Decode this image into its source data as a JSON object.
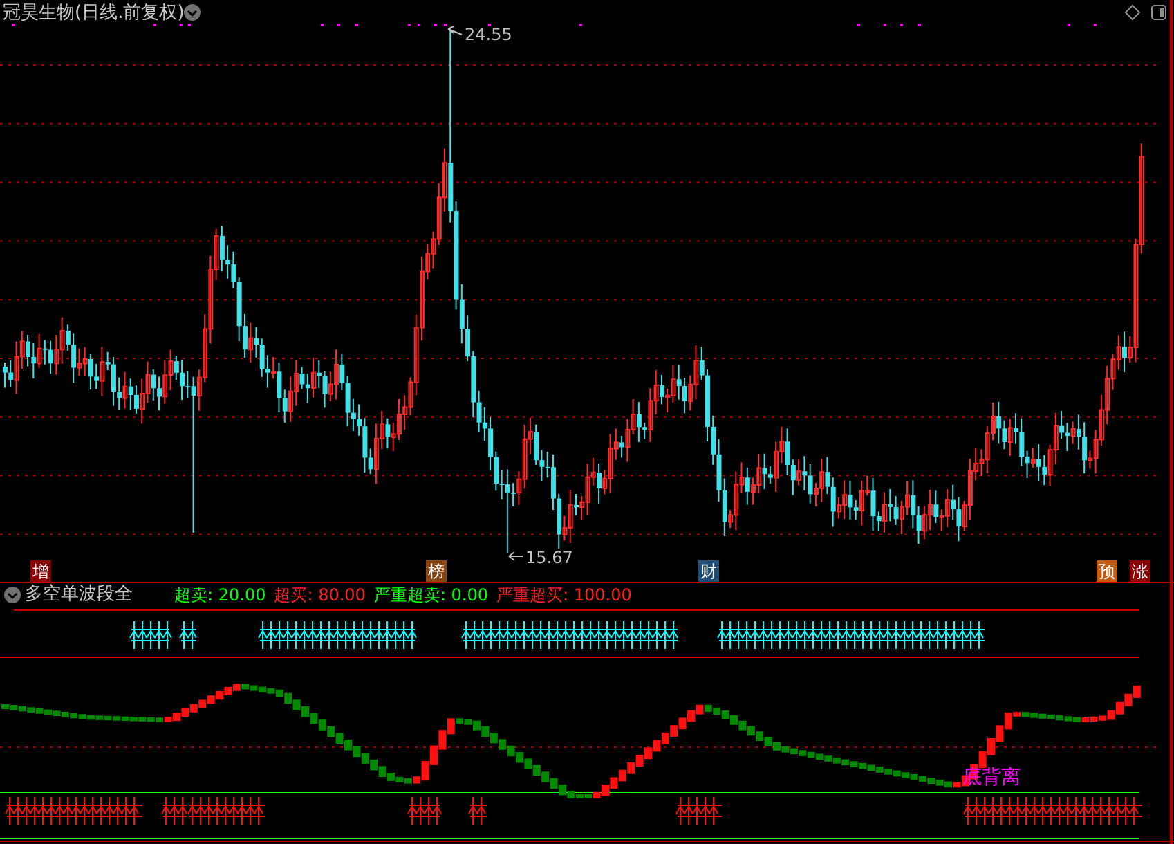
{
  "window": {
    "title": "冠昊生物(日线.前复权)"
  },
  "price_chart": {
    "high_label": "24.55",
    "low_label": "15.67",
    "event_badges": [
      {
        "label": "增",
        "color": "#8b0000"
      },
      {
        "label": "榜",
        "color": "#8b4513"
      },
      {
        "label": "财",
        "color": "#1f4e79"
      },
      {
        "label": "预",
        "color": "#c55a11"
      },
      {
        "label": "涨",
        "color": "#8b0000"
      }
    ]
  },
  "indicator": {
    "title": "多空单波段全",
    "legend": [
      {
        "label": "超卖:",
        "value": "20.00",
        "color": "#00ff00"
      },
      {
        "label": "超买:",
        "value": "80.00",
        "color": "#ff2020"
      },
      {
        "label": "严重超卖:",
        "value": "0.00",
        "color": "#00ff00"
      },
      {
        "label": "严重超买:",
        "value": "100.00",
        "color": "#ff2020"
      }
    ],
    "annotation": "底背离"
  }
}
